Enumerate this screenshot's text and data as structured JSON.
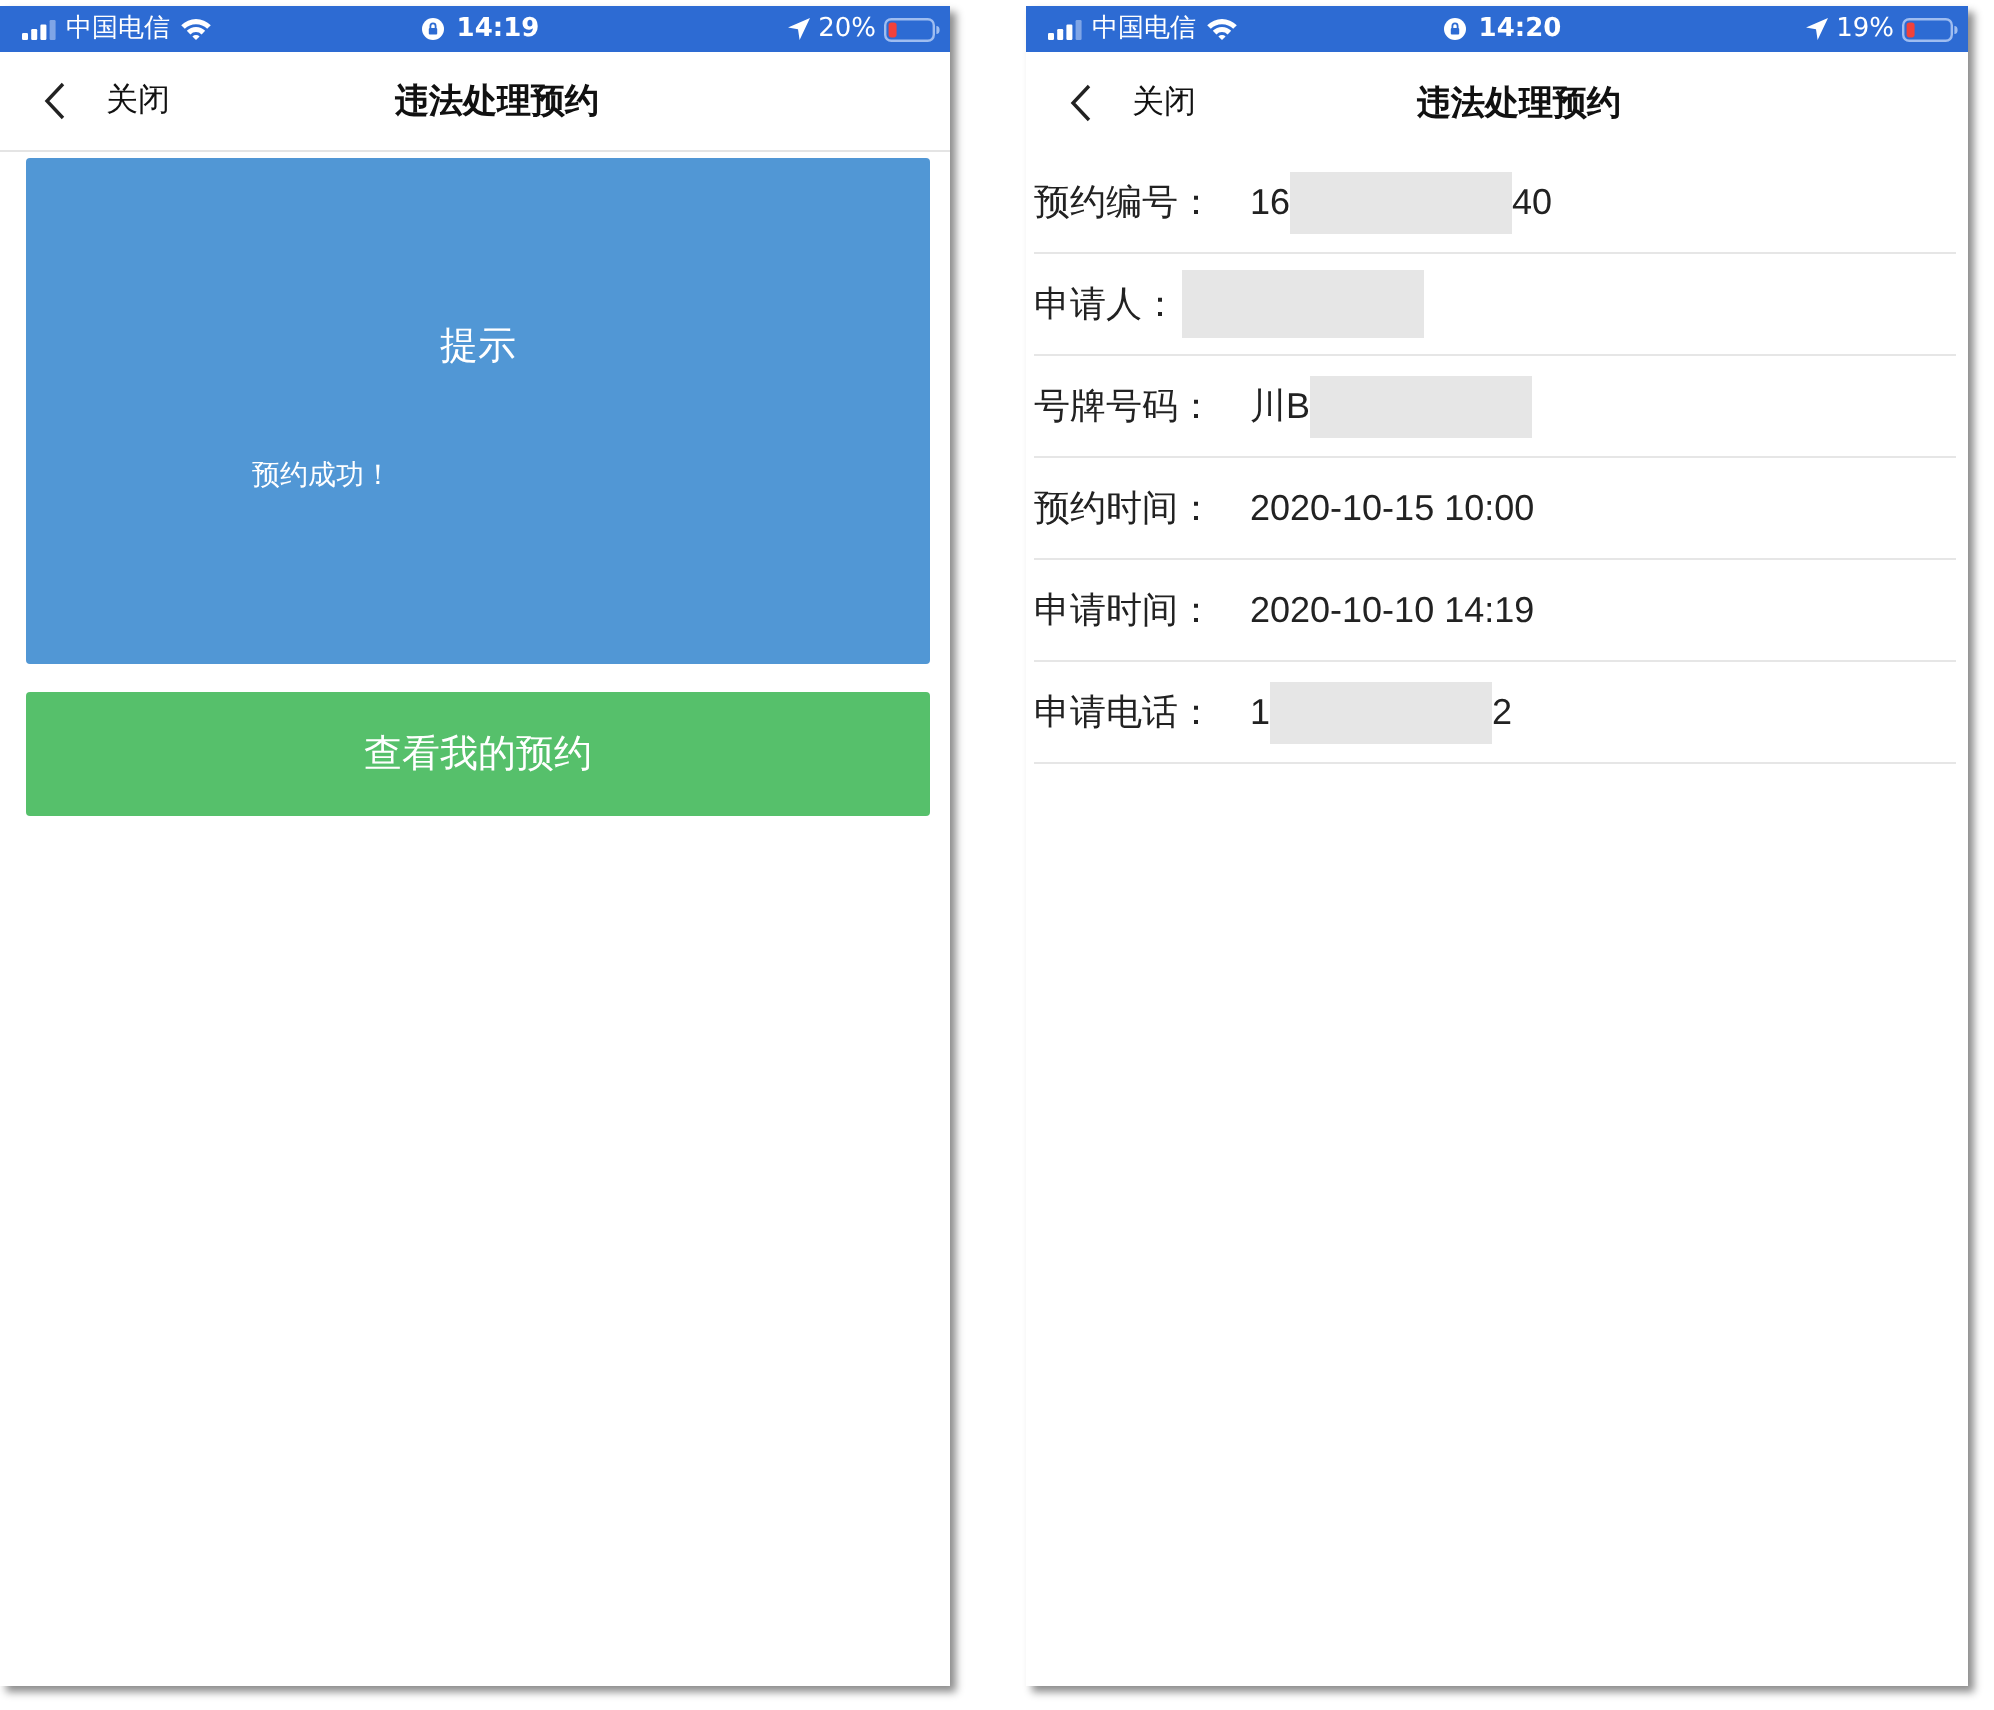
{
  "screens": [
    {
      "kind": "dialog",
      "status_bar": {
        "carrier": "中国电信",
        "time": "14:19",
        "battery": "20%"
      },
      "nav": {
        "close_label": "关闭",
        "title": "违法处理预约"
      },
      "dialog": {
        "title": "提示",
        "message": "预约成功！"
      },
      "button": {
        "label": "查看我的预约"
      }
    },
    {
      "kind": "details",
      "status_bar": {
        "carrier": "中国电信",
        "time": "14:20",
        "battery": "19%"
      },
      "nav": {
        "close_label": "关闭",
        "title": "违法处理预约"
      },
      "rows": [
        {
          "label": "预约编号：",
          "value_parts": [
            {
              "kind": "text",
              "text": "16"
            },
            {
              "kind": "redaction"
            },
            {
              "kind": "text",
              "text": "40"
            }
          ]
        },
        {
          "label": "申请人：",
          "value_parts": [
            {
              "kind": "redaction"
            }
          ]
        },
        {
          "label": "号牌号码：",
          "value_parts": [
            {
              "kind": "text",
              "text": "川B"
            },
            {
              "kind": "redaction"
            }
          ]
        },
        {
          "label": "预约时间：",
          "value_parts": [
            {
              "kind": "text",
              "text": "2020-10-15 10:00"
            }
          ]
        },
        {
          "label": "申请时间：",
          "value_parts": [
            {
              "kind": "text",
              "text": "2020-10-10 14:19"
            }
          ]
        },
        {
          "label": "申请电话：",
          "value_parts": [
            {
              "kind": "text",
              "text": "1"
            },
            {
              "kind": "redaction"
            },
            {
              "kind": "text",
              "text": "2"
            }
          ]
        }
      ]
    }
  ]
}
